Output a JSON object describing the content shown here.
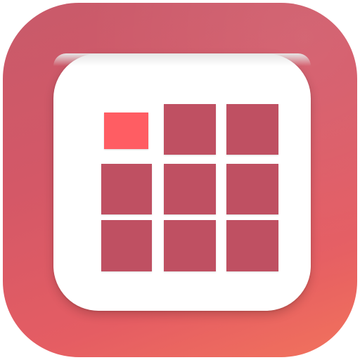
{
  "app_icon": {
    "icon": "puzzle-grid-icon",
    "colors": {
      "background_gradient_start": "#c85a6a",
      "background_gradient_end": "#f2735c",
      "card": "#ffffff",
      "tile": "#bf5062",
      "active_tile": "#ff5d63"
    }
  },
  "grid": {
    "rows": 3,
    "columns": 3,
    "tiles": [
      {
        "row": 1,
        "col": 1,
        "state": "active"
      },
      {
        "row": 1,
        "col": 2,
        "state": "normal"
      },
      {
        "row": 1,
        "col": 3,
        "state": "normal"
      },
      {
        "row": 2,
        "col": 1,
        "state": "normal"
      },
      {
        "row": 2,
        "col": 2,
        "state": "normal"
      },
      {
        "row": 2,
        "col": 3,
        "state": "normal"
      },
      {
        "row": 3,
        "col": 1,
        "state": "normal"
      },
      {
        "row": 3,
        "col": 2,
        "state": "normal"
      },
      {
        "row": 3,
        "col": 3,
        "state": "normal"
      }
    ]
  }
}
